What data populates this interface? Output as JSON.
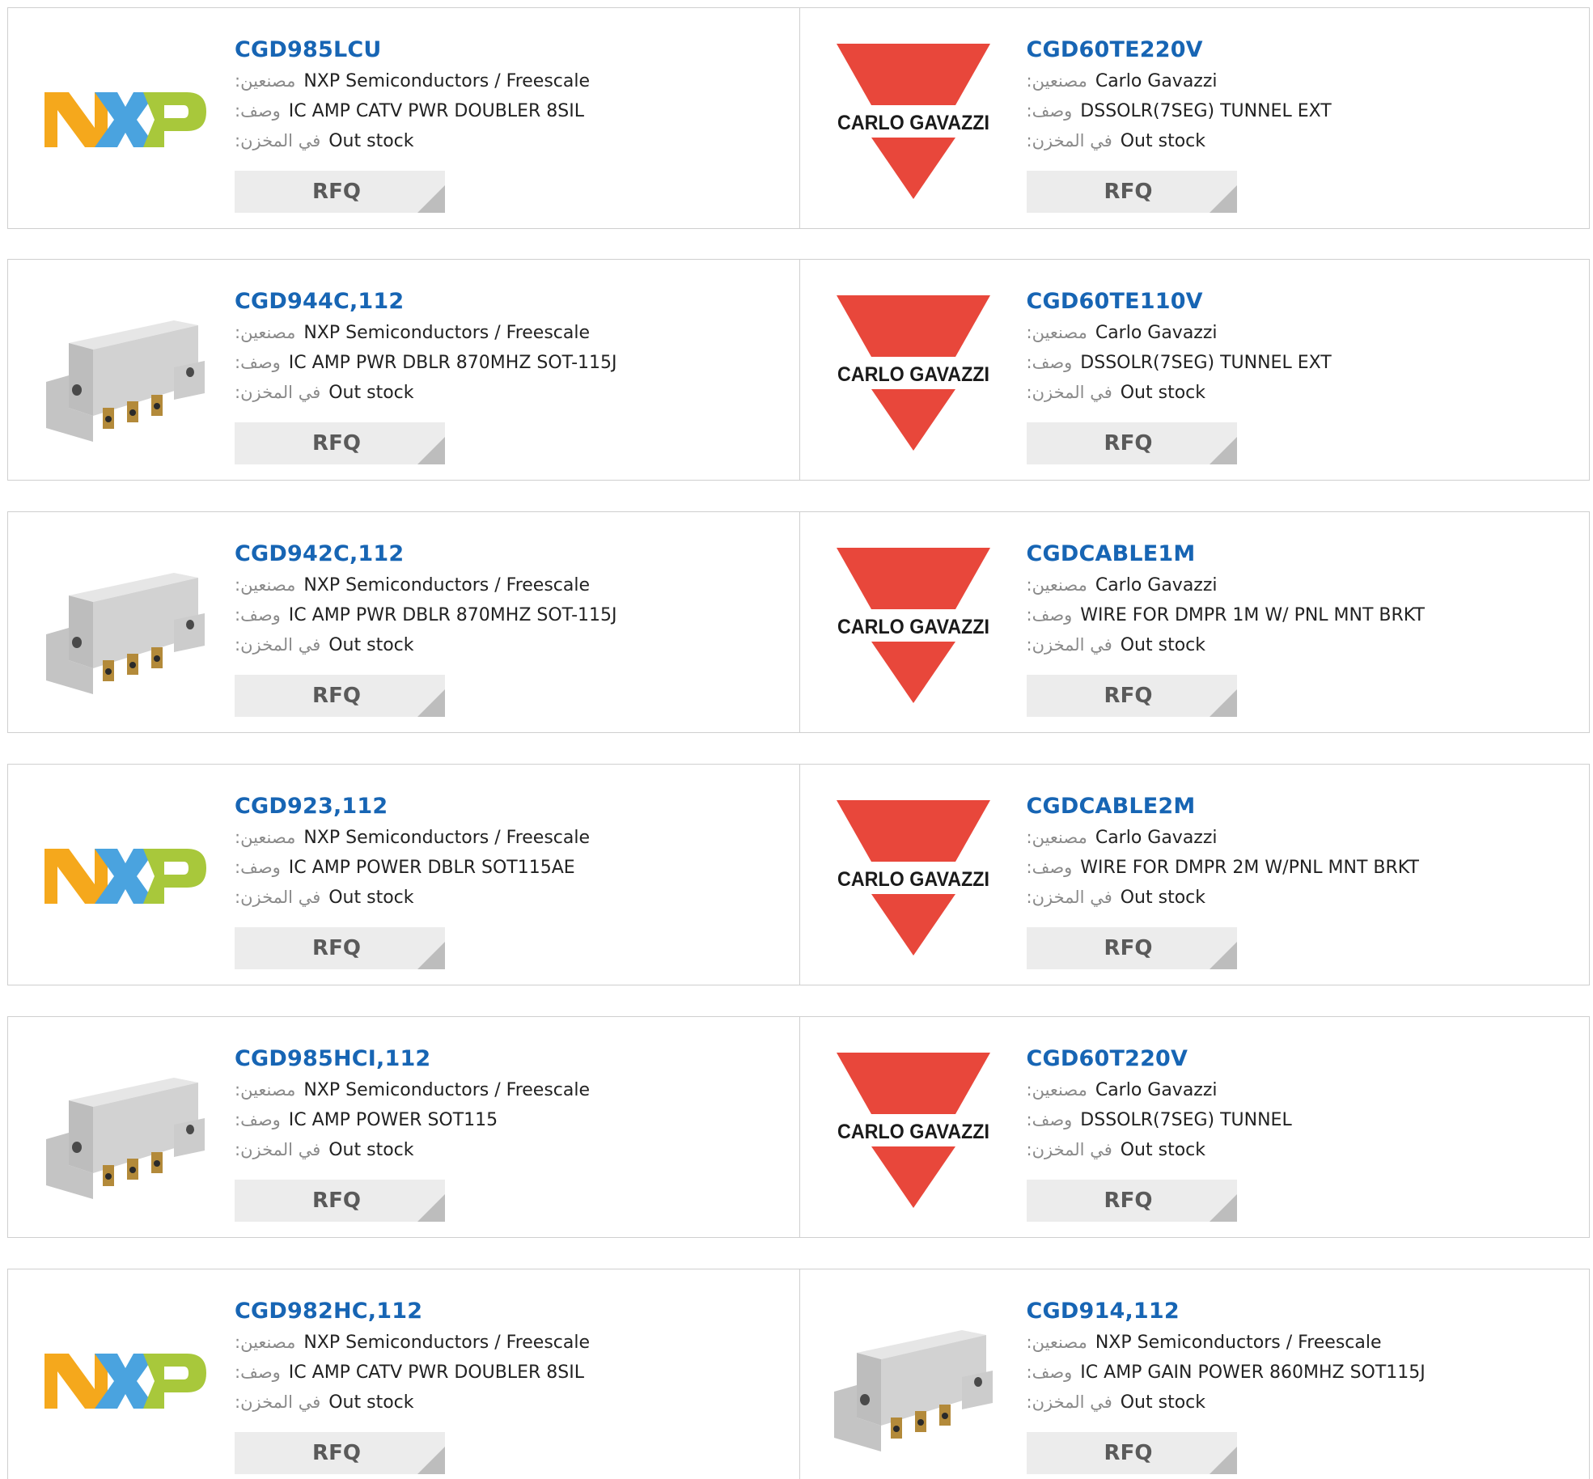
{
  "labels": {
    "manufacturer": ":مصنعين",
    "description": ":وصف",
    "stock": ":في المخزن",
    "rfq": "RFQ"
  },
  "products": [
    [
      {
        "part": "CGD985LCU",
        "manufacturer": "NXP Semiconductors / Freescale",
        "description": "IC AMP CATV PWR DOUBLER 8SIL",
        "stock": "Out stock",
        "image": "nxp-logo"
      },
      {
        "part": "CGD60TE220V",
        "manufacturer": "Carlo Gavazzi",
        "description": "DSSOLR(7SEG) TUNNEL EXT",
        "stock": "Out stock",
        "image": "carlo-gavazzi-logo",
        "logo_text": "CARLO GAVAZZI"
      }
    ],
    [
      {
        "part": "CGD944C,112",
        "manufacturer": "NXP Semiconductors / Freescale",
        "description": "IC AMP PWR DBLR 870MHZ SOT-115J",
        "stock": "Out stock",
        "image": "module-photo"
      },
      {
        "part": "CGD60TE110V",
        "manufacturer": "Carlo Gavazzi",
        "description": "DSSOLR(7SEG) TUNNEL EXT",
        "stock": "Out stock",
        "image": "carlo-gavazzi-logo",
        "logo_text": "CARLO GAVAZZI"
      }
    ],
    [
      {
        "part": "CGD942C,112",
        "manufacturer": "NXP Semiconductors / Freescale",
        "description": "IC AMP PWR DBLR 870MHZ SOT-115J",
        "stock": "Out stock",
        "image": "module-photo"
      },
      {
        "part": "CGDCABLE1M",
        "manufacturer": "Carlo Gavazzi",
        "description": "WIRE FOR DMPR 1M W/ PNL MNT BRKT",
        "stock": "Out stock",
        "image": "carlo-gavazzi-logo",
        "logo_text": "CARLO GAVAZZI"
      }
    ],
    [
      {
        "part": "CGD923,112",
        "manufacturer": "NXP Semiconductors / Freescale",
        "description": "IC AMP POWER DBLR SOT115AE",
        "stock": "Out stock",
        "image": "nxp-logo"
      },
      {
        "part": "CGDCABLE2M",
        "manufacturer": "Carlo Gavazzi",
        "description": "WIRE FOR DMPR 2M W/PNL MNT BRKT",
        "stock": "Out stock",
        "image": "carlo-gavazzi-logo",
        "logo_text": "CARLO GAVAZZI"
      }
    ],
    [
      {
        "part": "CGD985HCI,112",
        "manufacturer": "NXP Semiconductors / Freescale",
        "description": "IC AMP POWER SOT115",
        "stock": "Out stock",
        "image": "module-photo"
      },
      {
        "part": "CGD60T220V",
        "manufacturer": "Carlo Gavazzi",
        "description": "DSSOLR(7SEG) TUNNEL",
        "stock": "Out stock",
        "image": "carlo-gavazzi-logo",
        "logo_text": "CARLO GAVAZZI"
      }
    ],
    [
      {
        "part": "CGD982HC,112",
        "manufacturer": "NXP Semiconductors / Freescale",
        "description": "IC AMP CATV PWR DOUBLER 8SIL",
        "stock": "Out stock",
        "image": "nxp-logo"
      },
      {
        "part": "CGD914,112",
        "manufacturer": "NXP Semiconductors / Freescale",
        "description": "IC AMP GAIN POWER 860MHZ SOT115J",
        "stock": "Out stock",
        "image": "module-photo"
      }
    ]
  ],
  "colors": {
    "link": "#1765b4",
    "nxp_orange": "#f5a81c",
    "nxp_blue": "#4aa3df",
    "nxp_green": "#a8c83b",
    "gavazzi_red": "#e8473b",
    "button_bg": "#ececec"
  }
}
